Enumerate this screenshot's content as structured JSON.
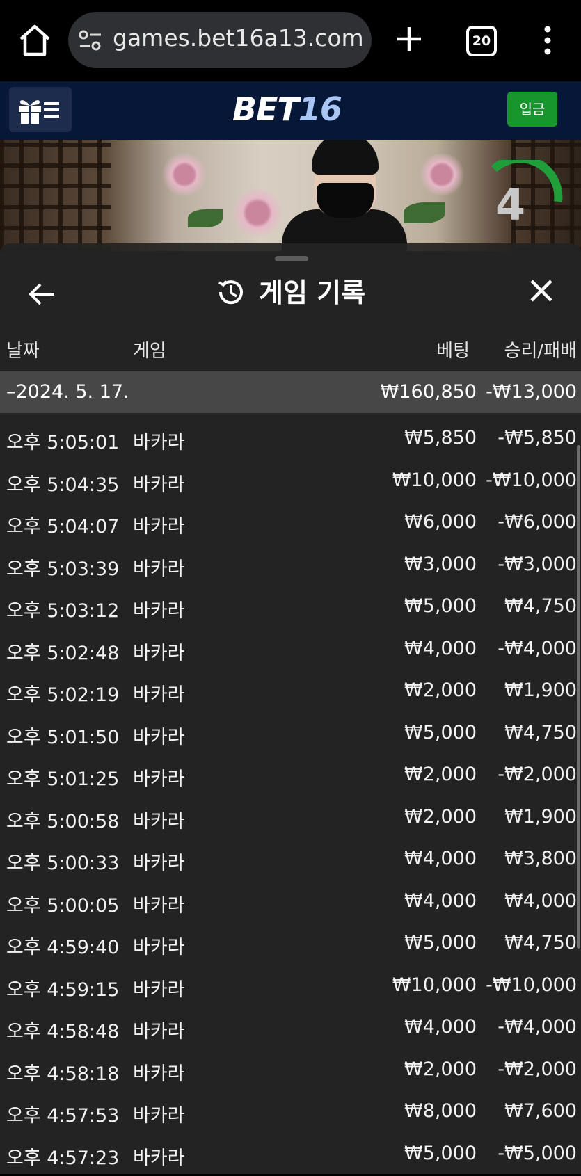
{
  "browser": {
    "url": "games.bet16a13.com/l",
    "tab_count": "20"
  },
  "site": {
    "logo_part1": "BET",
    "logo_part2": "16",
    "deposit_label": "입금"
  },
  "video": {
    "countdown": "4"
  },
  "history": {
    "title": "게임 기록",
    "columns": {
      "date": "날짜",
      "game": "게임",
      "bet": "베팅",
      "result": "승리/패배"
    },
    "day": {
      "date": "–2024. 5. 17.",
      "bet": "₩160,850",
      "result": "-₩13,000"
    },
    "rows": [
      {
        "time": "오후 5:05:01",
        "game": "바카라",
        "bet": "₩5,850",
        "result": "-₩5,850"
      },
      {
        "time": "오후 5:04:35",
        "game": "바카라",
        "bet": "₩10,000",
        "result": "-₩10,000"
      },
      {
        "time": "오후 5:04:07",
        "game": "바카라",
        "bet": "₩6,000",
        "result": "-₩6,000"
      },
      {
        "time": "오후 5:03:39",
        "game": "바카라",
        "bet": "₩3,000",
        "result": "-₩3,000"
      },
      {
        "time": "오후 5:03:12",
        "game": "바카라",
        "bet": "₩5,000",
        "result": "₩4,750"
      },
      {
        "time": "오후 5:02:48",
        "game": "바카라",
        "bet": "₩4,000",
        "result": "-₩4,000"
      },
      {
        "time": "오후 5:02:19",
        "game": "바카라",
        "bet": "₩2,000",
        "result": "₩1,900"
      },
      {
        "time": "오후 5:01:50",
        "game": "바카라",
        "bet": "₩5,000",
        "result": "₩4,750"
      },
      {
        "time": "오후 5:01:25",
        "game": "바카라",
        "bet": "₩2,000",
        "result": "-₩2,000"
      },
      {
        "time": "오후 5:00:58",
        "game": "바카라",
        "bet": "₩2,000",
        "result": "₩1,900"
      },
      {
        "time": "오후 5:00:33",
        "game": "바카라",
        "bet": "₩4,000",
        "result": "₩3,800"
      },
      {
        "time": "오후 5:00:05",
        "game": "바카라",
        "bet": "₩4,000",
        "result": "₩4,000"
      },
      {
        "time": "오후 4:59:40",
        "game": "바카라",
        "bet": "₩5,000",
        "result": "₩4,750"
      },
      {
        "time": "오후 4:59:15",
        "game": "바카라",
        "bet": "₩10,000",
        "result": "-₩10,000"
      },
      {
        "time": "오후 4:58:48",
        "game": "바카라",
        "bet": "₩4,000",
        "result": "-₩4,000"
      },
      {
        "time": "오후 4:58:18",
        "game": "바카라",
        "bet": "₩2,000",
        "result": "-₩2,000"
      },
      {
        "time": "오후 4:57:53",
        "game": "바카라",
        "bet": "₩8,000",
        "result": "₩7,600"
      },
      {
        "time": "오후 4:57:23",
        "game": "바카라",
        "bet": "₩5,000",
        "result": "-₩5,000"
      }
    ]
  },
  "colors": {
    "header_bg": "#071738",
    "deposit_green": "#17962d",
    "panel_bg": "#242424",
    "day_row_bg": "#474747",
    "timer_green": "#1f9e3a"
  }
}
